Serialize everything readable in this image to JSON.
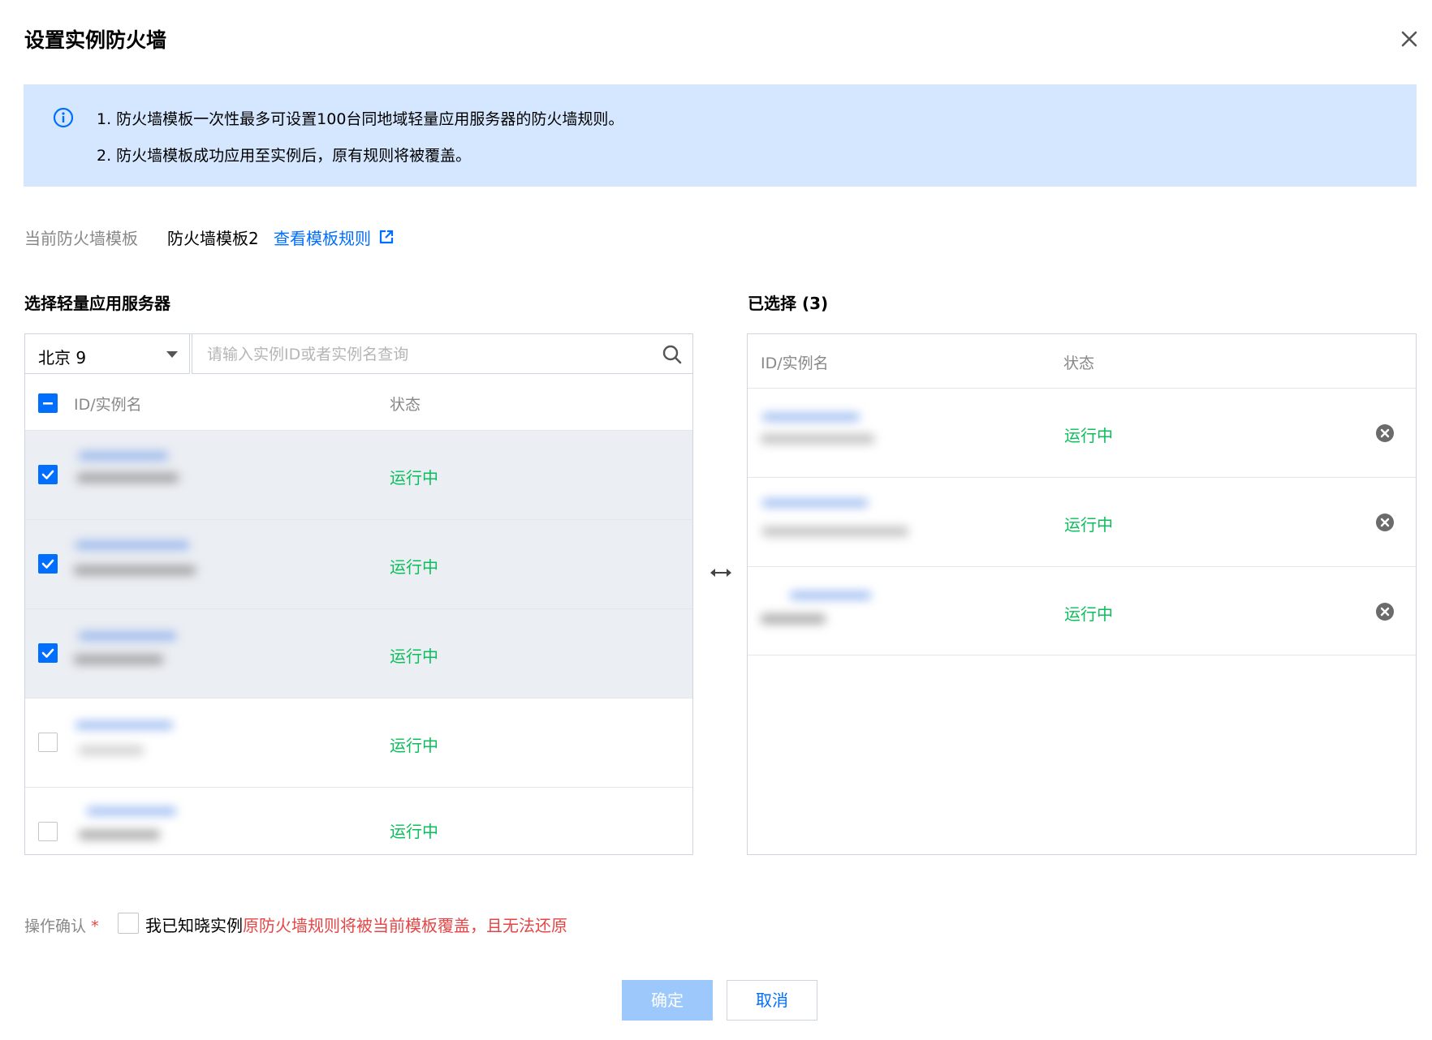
{
  "dialog": {
    "title": "设置实例防火墙"
  },
  "notice": {
    "line1": "1. 防火墙模板一次性最多可设置100台同地域轻量应用服务器的防火墙规则。",
    "line2": "2. 防火墙模板成功应用至实例后，原有规则将被覆盖。"
  },
  "current_template": {
    "label": "当前防火墙模板",
    "value": "防火墙模板2",
    "link": "查看模板规则"
  },
  "left_panel": {
    "title": "选择轻量应用服务器",
    "region": "北京 9",
    "search_placeholder": "请输入实例ID或者实例名查询",
    "col_id": "ID/实例名",
    "col_status": "状态",
    "rows": [
      {
        "status": "运行中",
        "checked": true
      },
      {
        "status": "运行中",
        "checked": true
      },
      {
        "status": "运行中",
        "checked": true
      },
      {
        "status": "运行中",
        "checked": false
      },
      {
        "status": "运行中",
        "checked": false
      }
    ]
  },
  "right_panel": {
    "title": "已选择 (3)",
    "col_id": "ID/实例名",
    "col_status": "状态",
    "rows": [
      {
        "status": "运行中"
      },
      {
        "status": "运行中"
      },
      {
        "status": "运行中"
      }
    ]
  },
  "confirm": {
    "label": "操作确认",
    "required": "*",
    "text": "我已知晓实例",
    "warning": "原防火墙规则将被当前模板覆盖，且无法还原"
  },
  "buttons": {
    "ok": "确定",
    "cancel": "取消"
  },
  "colors": {
    "accent": "#006eff",
    "running": "#0abf5b",
    "warning": "#e54545",
    "notice_bg": "#d5e7ff"
  }
}
